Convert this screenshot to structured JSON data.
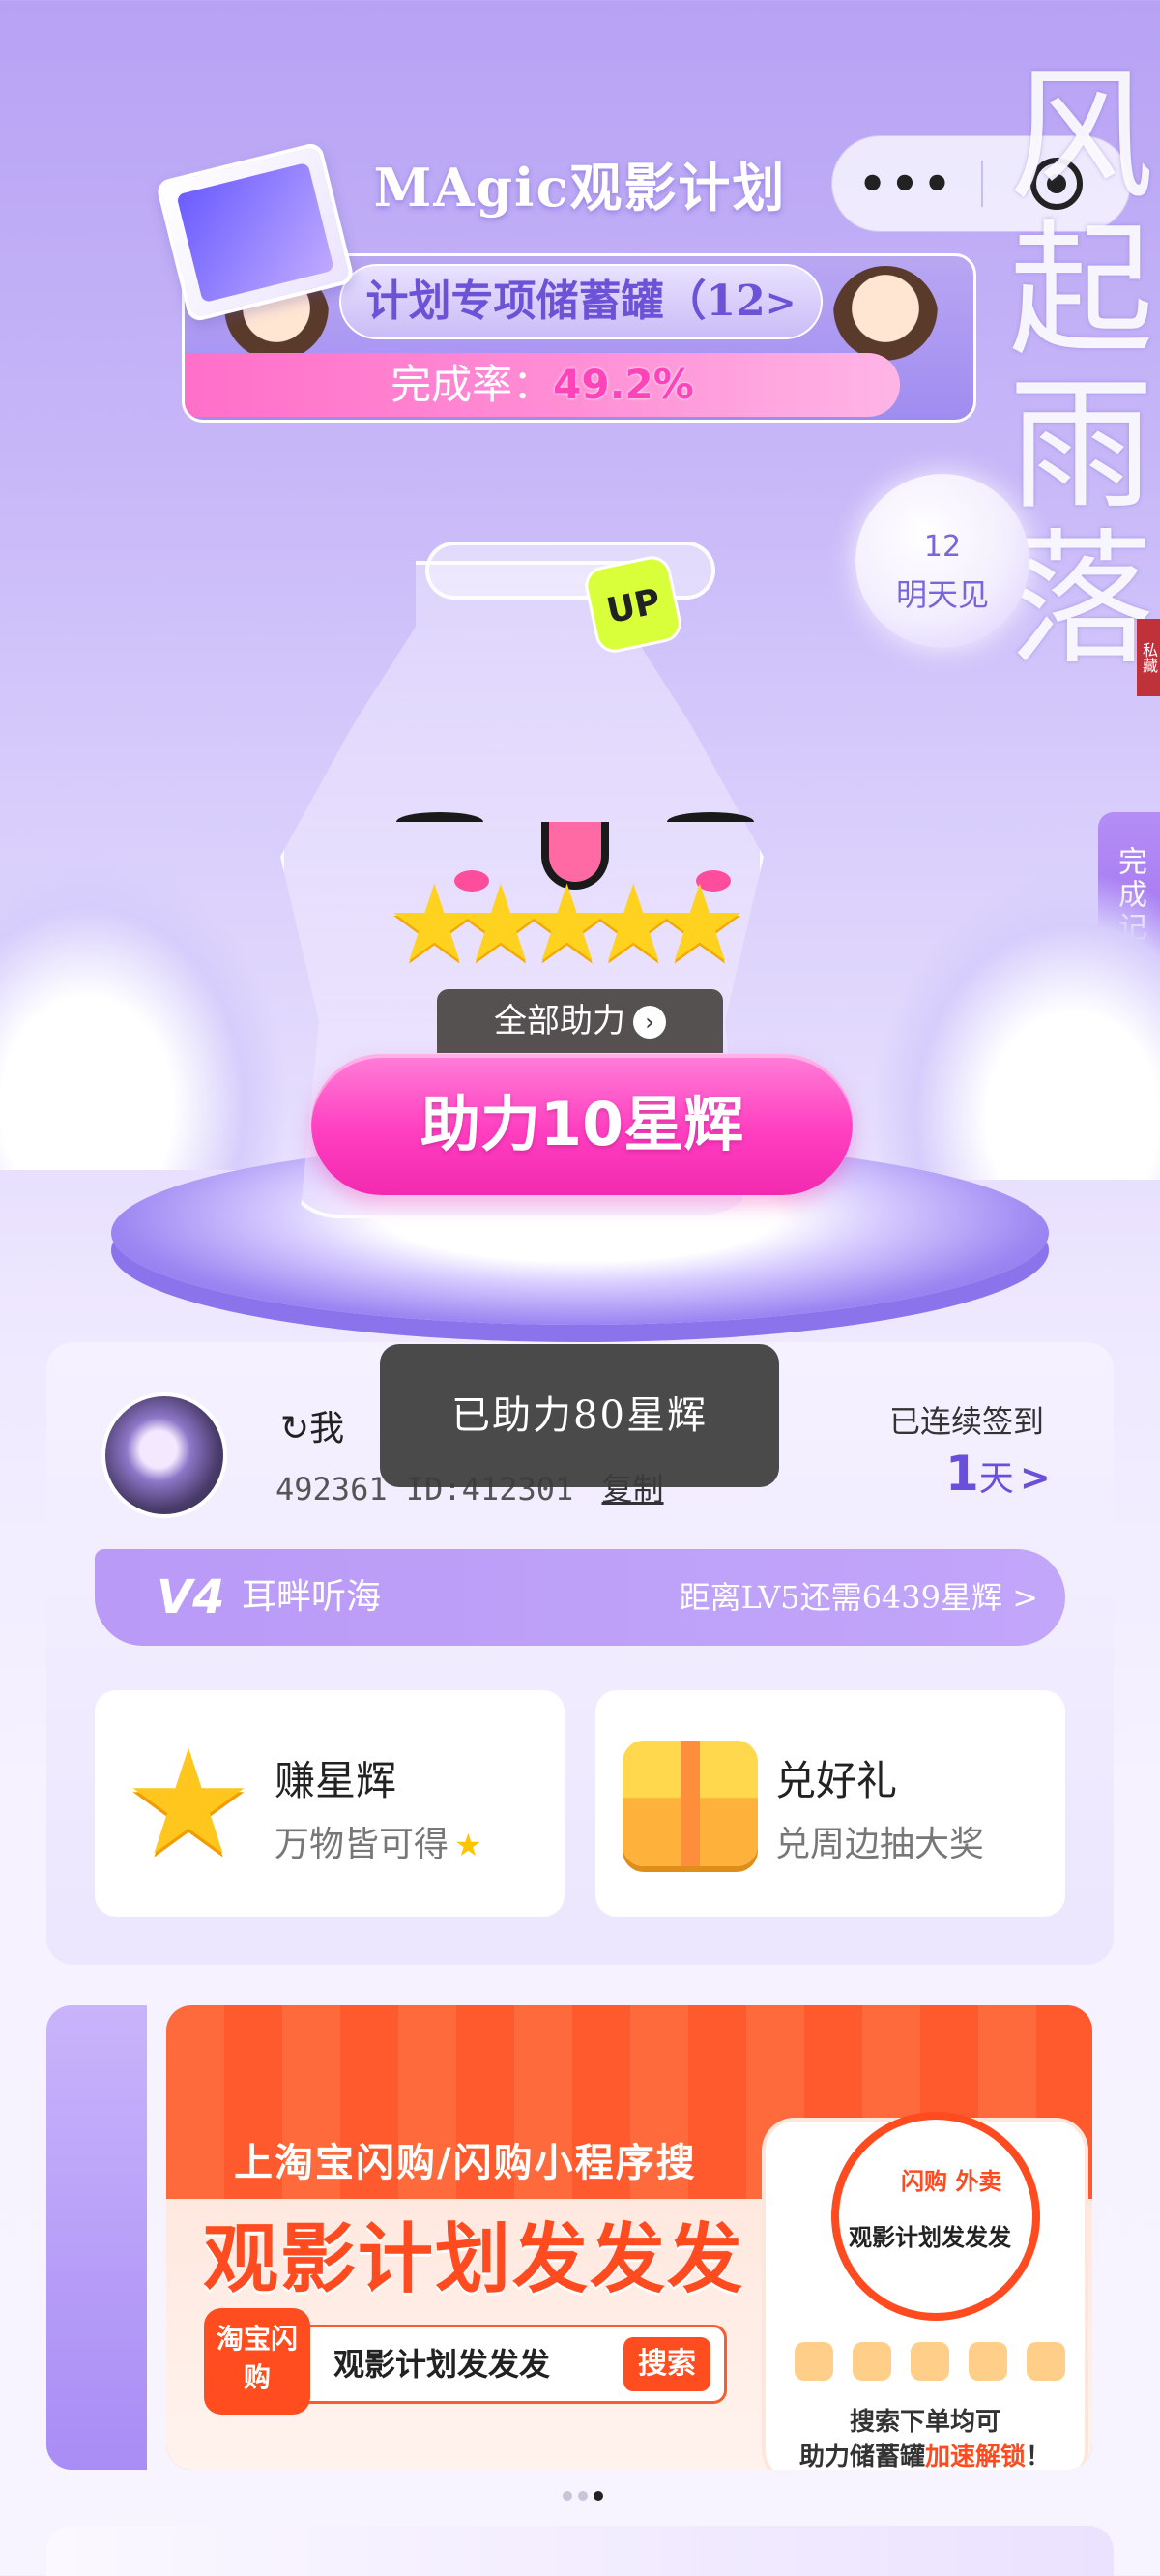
{
  "header": {
    "title": "MAgic观影计划",
    "capsule": {
      "more_label": "•••",
      "target_icon": "target-icon"
    }
  },
  "bank": {
    "title": "计划专项储蓄罐（12",
    "arrow": ">",
    "rate_label": "完成率：",
    "rate_value": "49.2%",
    "rate_fraction": 0.492
  },
  "countdown": {
    "number": "12",
    "text": "明天见"
  },
  "calligraphy": "风起雨落",
  "seal": "私藏",
  "side_tab": {
    "label": "完成记录"
  },
  "jar": {
    "up_badge": "UP"
  },
  "help_all": {
    "label": "全部助力",
    "icon": "chevron-right-circle-icon"
  },
  "boost_button": {
    "label": "助力10星辉"
  },
  "toast": {
    "text": "已助力80星辉"
  },
  "user": {
    "refresh_name": "↻我",
    "id_left": "492361",
    "id_label": "ID:412301",
    "copy_label": "复制",
    "checkin_label": "已连续签到",
    "checkin_days": "1",
    "checkin_unit": "天",
    "checkin_chevron": ">"
  },
  "level": {
    "badge": "V4",
    "name": "耳畔听海",
    "next_text": "距离LV5还需6439星辉",
    "chevron": ">"
  },
  "tiles": [
    {
      "title": "赚星辉",
      "subtitle": "万物皆可得",
      "icon": "star-mascot-icon",
      "subtitle_icon": "★"
    },
    {
      "title": "兑好礼",
      "subtitle": "兑周边抽大奖",
      "icon": "gift-mascot-icon"
    }
  ],
  "ad": {
    "line1": "上淘宝闪购/闪购小程序搜",
    "line2": "观影计划发发发",
    "logo": "淘宝闪购",
    "search_query": "观影计划发发发",
    "search_button": "搜索",
    "phone_brand": "闪购 外卖",
    "phone_query": "观影计划发发发",
    "caption1": "搜索下单均可",
    "caption2_a": "助力储蓄罐",
    "caption2_b": "加速解锁",
    "caption2_c": "！"
  },
  "carousel": {
    "count": 3,
    "active": 2
  }
}
